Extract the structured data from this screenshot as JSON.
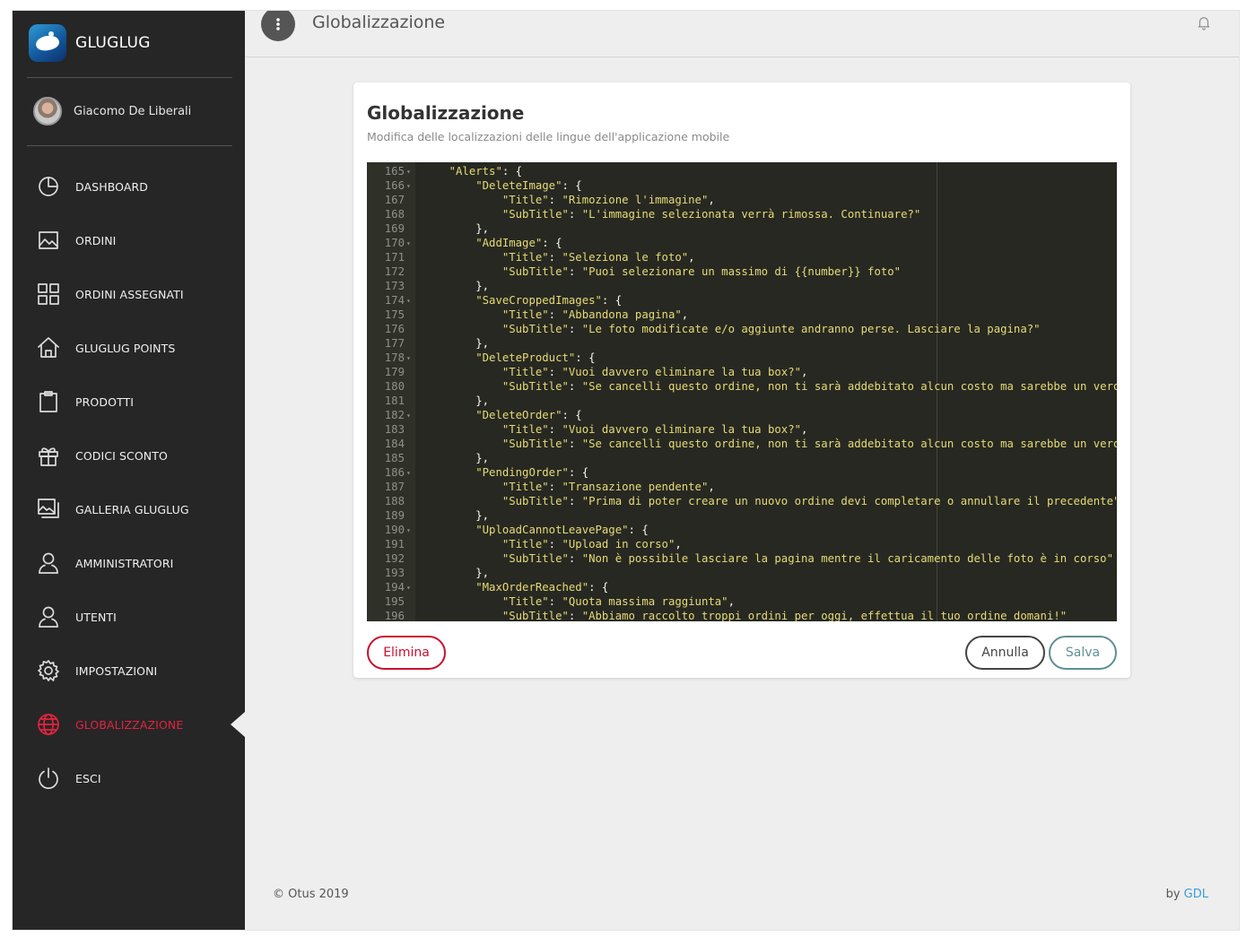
{
  "brand": {
    "name": "GLUGLUG"
  },
  "user": {
    "name": "Giacomo De Liberali"
  },
  "nav": [
    {
      "label": "DASHBOARD",
      "icon": "pie-chart-icon"
    },
    {
      "label": "ORDINI",
      "icon": "image-icon"
    },
    {
      "label": "ORDINI ASSEGNATI",
      "icon": "grid-icon"
    },
    {
      "label": "GLUGLUG POINTS",
      "icon": "home-icon"
    },
    {
      "label": "PRODOTTI",
      "icon": "clipboard-icon"
    },
    {
      "label": "CODICI SCONTO",
      "icon": "gift-icon"
    },
    {
      "label": "GALLERIA GLUGLUG",
      "icon": "gallery-icon"
    },
    {
      "label": "AMMINISTRATORI",
      "icon": "user-icon"
    },
    {
      "label": "UTENTI",
      "icon": "user-icon"
    },
    {
      "label": "IMPOSTAZIONI",
      "icon": "gear-icon"
    },
    {
      "label": "GLOBALIZZAZIONE",
      "icon": "globe-icon",
      "active": true
    },
    {
      "label": "ESCI",
      "icon": "power-icon"
    }
  ],
  "header": {
    "title": "Globalizzazione"
  },
  "card": {
    "title": "Globalizzazione",
    "subtitle": "Modifica delle localizzazioni delle lingue dell'applicazione mobile"
  },
  "editor": {
    "lines": [
      {
        "n": "165",
        "fold": true,
        "code": "    \"Alerts\": {"
      },
      {
        "n": "166",
        "fold": true,
        "code": "        \"DeleteImage\": {"
      },
      {
        "n": "167",
        "fold": false,
        "code": "            \"Title\": \"Rimozione l'immagine\","
      },
      {
        "n": "168",
        "fold": false,
        "code": "            \"SubTitle\": \"L'immagine selezionata verrà rimossa. Continuare?\""
      },
      {
        "n": "169",
        "fold": false,
        "code": "        },"
      },
      {
        "n": "170",
        "fold": true,
        "code": "        \"AddImage\": {"
      },
      {
        "n": "171",
        "fold": false,
        "code": "            \"Title\": \"Seleziona le foto\","
      },
      {
        "n": "172",
        "fold": false,
        "code": "            \"SubTitle\": \"Puoi selezionare un massimo di {{number}} foto\""
      },
      {
        "n": "173",
        "fold": false,
        "code": "        },"
      },
      {
        "n": "174",
        "fold": true,
        "code": "        \"SaveCroppedImages\": {"
      },
      {
        "n": "175",
        "fold": false,
        "code": "            \"Title\": \"Abbandona pagina\","
      },
      {
        "n": "176",
        "fold": false,
        "code": "            \"SubTitle\": \"Le foto modificate e/o aggiunte andranno perse. Lasciare la pagina?\""
      },
      {
        "n": "177",
        "fold": false,
        "code": "        },"
      },
      {
        "n": "178",
        "fold": true,
        "code": "        \"DeleteProduct\": {"
      },
      {
        "n": "179",
        "fold": false,
        "code": "            \"Title\": \"Vuoi davvero eliminare la tua box?\","
      },
      {
        "n": "180",
        "fold": false,
        "code": "            \"SubTitle\": \"Se cancelli questo ordine, non ti sarà addebitato alcun costo ma sarebbe un vero pe"
      },
      {
        "n": "181",
        "fold": false,
        "code": "        },"
      },
      {
        "n": "182",
        "fold": true,
        "code": "        \"DeleteOrder\": {"
      },
      {
        "n": "183",
        "fold": false,
        "code": "            \"Title\": \"Vuoi davvero eliminare la tua box?\","
      },
      {
        "n": "184",
        "fold": false,
        "code": "            \"SubTitle\": \"Se cancelli questo ordine, non ti sarà addebitato alcun costo ma sarebbe un vero pe"
      },
      {
        "n": "185",
        "fold": false,
        "code": "        },"
      },
      {
        "n": "186",
        "fold": true,
        "code": "        \"PendingOrder\": {"
      },
      {
        "n": "187",
        "fold": false,
        "code": "            \"Title\": \"Transazione pendente\","
      },
      {
        "n": "188",
        "fold": false,
        "code": "            \"SubTitle\": \"Prima di poter creare un nuovo ordine devi completare o annullare il precedente\""
      },
      {
        "n": "189",
        "fold": false,
        "code": "        },"
      },
      {
        "n": "190",
        "fold": true,
        "code": "        \"UploadCannotLeavePage\": {"
      },
      {
        "n": "191",
        "fold": false,
        "code": "            \"Title\": \"Upload in corso\","
      },
      {
        "n": "192",
        "fold": false,
        "code": "            \"SubTitle\": \"Non è possibile lasciare la pagina mentre il caricamento delle foto è in corso\""
      },
      {
        "n": "193",
        "fold": false,
        "code": "        },"
      },
      {
        "n": "194",
        "fold": true,
        "code": "        \"MaxOrderReached\": {"
      },
      {
        "n": "195",
        "fold": false,
        "code": "            \"Title\": \"Quota massima raggiunta\","
      },
      {
        "n": "196",
        "fold": false,
        "code": "            \"SubTitle\": \"Abbiamo raccolto troppi ordini per oggi, effettua il tuo ordine domani!\""
      }
    ]
  },
  "actions": {
    "delete": "Elimina",
    "cancel": "Annulla",
    "save": "Salva"
  },
  "footer": {
    "copyright": "© Otus 2019",
    "by": "by",
    "author": "GDL"
  },
  "colors": {
    "active": "#e3233f",
    "sidebar": "#262626",
    "editor_bg": "#272822",
    "string": "#e6db74"
  }
}
